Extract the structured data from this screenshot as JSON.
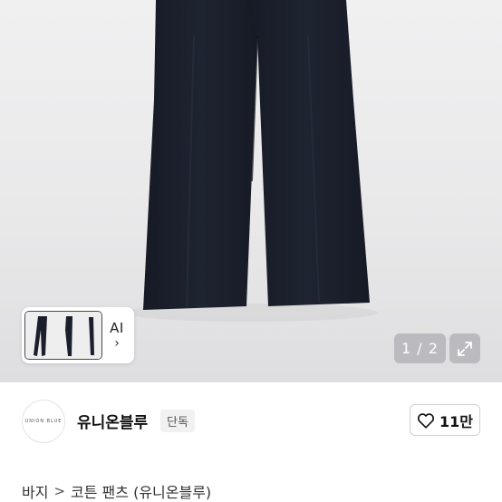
{
  "gallery": {
    "image_alt": "navy wide-leg cotton pants",
    "ai_button_label": "AI",
    "ai_chevron": "›",
    "page_indicator": "1 / 2",
    "expand_icon": "expand-icon"
  },
  "brand": {
    "logo_text": "UNION BLUE",
    "name": "유니온블루",
    "badge": "단독",
    "like_count": "11만",
    "like_icon": "heart-icon"
  },
  "breadcrumb": {
    "category": "바지",
    "separator": ">",
    "product": "코튼 팬츠 (유니온블루)"
  },
  "colors": {
    "pants": "#1b1f2b",
    "background": "#ececed",
    "overlay": "#b4b4b8"
  }
}
